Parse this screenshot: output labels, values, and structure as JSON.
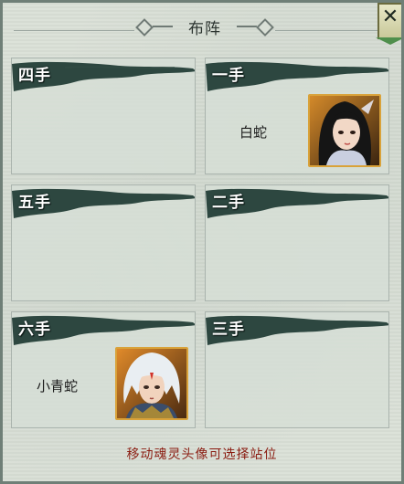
{
  "title": "布阵",
  "close_label": "✕",
  "slots": [
    {
      "label": "四手",
      "hero": ""
    },
    {
      "label": "一手",
      "hero": "白蛇"
    },
    {
      "label": "五手",
      "hero": ""
    },
    {
      "label": "二手",
      "hero": ""
    },
    {
      "label": "六手",
      "hero": "小青蛇"
    },
    {
      "label": "三手",
      "hero": ""
    }
  ],
  "footer_hint": "移动魂灵头像可选择站位",
  "colors": {
    "panel_bg": "#d9dfd6",
    "brush_stroke": "#1e3a33",
    "portrait_border": "#d9a23a",
    "hint_text": "#8b1d12"
  },
  "icons": {
    "close": "close-icon",
    "white-snake-portrait": "portrait",
    "green-snake-portrait": "portrait"
  }
}
